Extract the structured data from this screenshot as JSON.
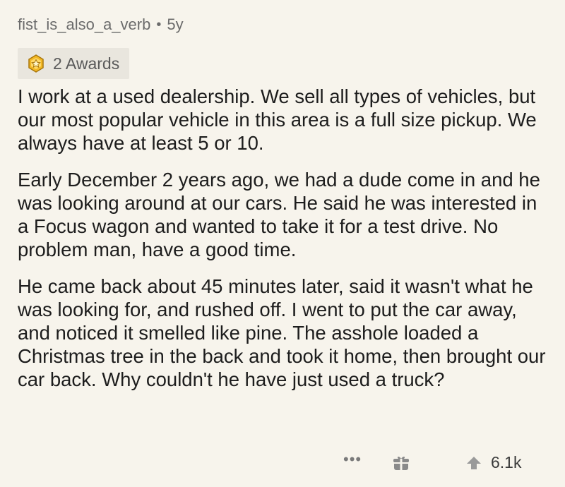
{
  "comment": {
    "username": "fist_is_also_a_verb",
    "separator": "•",
    "age": "5y",
    "awards_label": "2 Awards",
    "paragraphs": [
      "I work at a used dealership.  We sell all types of vehicles, but our most popular vehicle in this area is a full size pickup.  We always have at least 5 or 10.",
      "Early December 2 years ago, we had a dude come in and he was looking around at our cars.  He said he was interested in a Focus wagon and wanted to take it for a test drive.  No problem man, have a good time.",
      "He came back about 45 minutes later, said it wasn't what he was looking for, and rushed off.  I went to put the car away, and noticed it smelled like pine.  The asshole loaded a Christmas tree in the back and took it home, then brought our car back.  Why couldn't he have just used a truck?"
    ],
    "more_label": "•••",
    "score": "6.1k"
  },
  "icons": {
    "award": "award-star-icon",
    "gift": "gift-icon",
    "upvote": "upvote-arrow-icon"
  },
  "colors": {
    "background": "#f7f4ec",
    "award_badge_bg": "#e9e6de",
    "award_gold": "#f2b824"
  }
}
